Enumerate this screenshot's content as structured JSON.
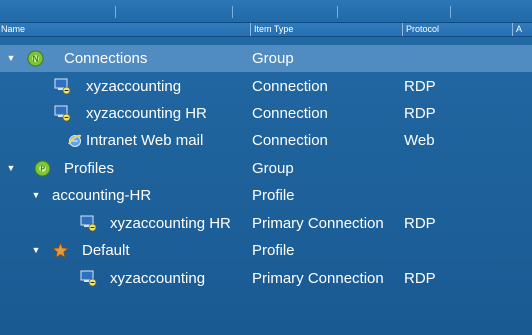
{
  "columns": [
    "Name",
    "Item Type",
    "Protocol",
    "A"
  ],
  "rows": [
    {
      "name": "Connections",
      "type": "Group",
      "protocol": "",
      "expander": "▼",
      "icon": "group-icon"
    },
    {
      "name": "xyzaccounting",
      "type": "Connection",
      "protocol": "RDP",
      "icon": "rdp-connection-icon"
    },
    {
      "name": "xyzaccounting HR",
      "type": "Connection",
      "protocol": "RDP",
      "icon": "rdp-connection-icon"
    },
    {
      "name": "Intranet Web mail",
      "type": "Connection",
      "protocol": "Web",
      "icon": "web-browser-icon"
    },
    {
      "name": "Profiles",
      "type": "Group",
      "protocol": "",
      "expander": "▼",
      "icon": "group-icon"
    },
    {
      "name": "accounting-HR",
      "type": "Profile",
      "protocol": "",
      "expander": "▼",
      "icon": ""
    },
    {
      "name": "xyzaccounting HR",
      "type": "Primary Connection",
      "protocol": "RDP",
      "icon": "rdp-connection-icon"
    },
    {
      "name": "Default",
      "type": "Profile",
      "protocol": "",
      "expander": "▼",
      "icon": "profile-star-icon"
    },
    {
      "name": "xyzaccounting",
      "type": "Primary Connection",
      "protocol": "RDP",
      "icon": "rdp-connection-icon"
    }
  ],
  "colors": {
    "background": "#1f639d",
    "header": "#2f7bbd",
    "selected_row": "#78aadc",
    "group_icon": "#8bd13f"
  }
}
